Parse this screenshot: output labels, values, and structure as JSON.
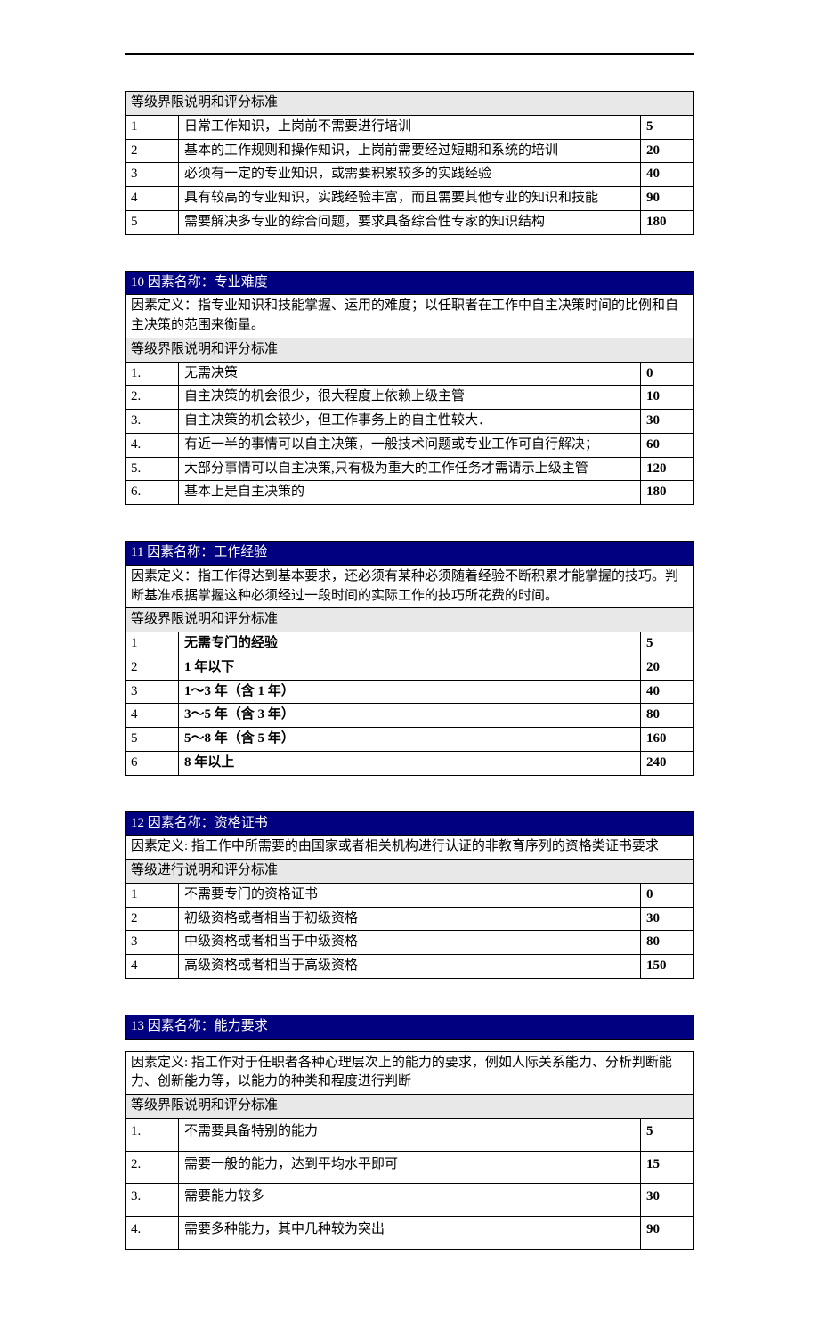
{
  "labels": {
    "scale_header": "等级界限说明和评分标准",
    "scale_header_alt": "等级进行说明和评分标准"
  },
  "block0": {
    "rows": [
      {
        "lvl": "1",
        "desc": "日常工作知识，上岗前不需要进行培训",
        "score": "5"
      },
      {
        "lvl": "2",
        "desc": "基本的工作规则和操作知识，上岗前需要经过短期和系统的培训",
        "score": "20"
      },
      {
        "lvl": "3",
        "desc": "必须有一定的专业知识，或需要积累较多的实践经验",
        "score": "40"
      },
      {
        "lvl": "4",
        "desc": "具有较高的专业知识，实践经验丰富，而且需要其他专业的知识和技能",
        "score": "90"
      },
      {
        "lvl": "5",
        "desc": "需要解决多专业的综合问题，要求具备综合性专家的知识结构",
        "score": "180"
      }
    ]
  },
  "block10": {
    "title": "10 因素名称：专业难度",
    "definition": "因素定义：指专业知识和技能掌握、运用的难度；以任职者在工作中自主决策时间的比例和自主决策的范围来衡量。",
    "rows": [
      {
        "lvl": "1.",
        "desc": "无需决策",
        "score": "0"
      },
      {
        "lvl": "2.",
        "desc": "自主决策的机会很少，很大程度上依赖上级主管",
        "score": "10"
      },
      {
        "lvl": "3.",
        "desc": "自主决策的机会较少，但工作事务上的自主性较大．",
        "score": "30"
      },
      {
        "lvl": "4.",
        "desc": "有近一半的事情可以自主决策，一般技术问题或专业工作可自行解决；",
        "score": "60"
      },
      {
        "lvl": "5.",
        "desc": "大部分事情可以自主决策,只有极为重大的工作任务才需请示上级主管",
        "score": "120"
      },
      {
        "lvl": "6.",
        "desc": "基本上是自主决策的",
        "score": "180"
      }
    ]
  },
  "block11": {
    "title": "11 因素名称：工作经验",
    "definition": "因素定义：指工作得达到基本要求，还必须有某种必须随着经验不断积累才能掌握的技巧。判断基准根据掌握这种必须经过一段时间的实际工作的技巧所花费的时间。",
    "rows": [
      {
        "lvl": "1",
        "desc": "无需专门的经验",
        "score": "5"
      },
      {
        "lvl": "2",
        "desc": "1 年以下",
        "score": "20"
      },
      {
        "lvl": "3",
        "desc": "1～3 年（含 1 年）",
        "score": "40"
      },
      {
        "lvl": "4",
        "desc": "3～5 年（含 3 年）",
        "score": "80"
      },
      {
        "lvl": "5",
        "desc": "5～8 年（含 5 年）",
        "score": "160"
      },
      {
        "lvl": "6",
        "desc": "8 年以上",
        "score": "240"
      }
    ]
  },
  "block12": {
    "title": "12 因素名称：资格证书",
    "definition": "因素定义: 指工作中所需要的由国家或者相关机构进行认证的非教育序列的资格类证书要求",
    "rows": [
      {
        "lvl": "1",
        "desc": "不需要专门的资格证书",
        "score": "0"
      },
      {
        "lvl": "2",
        "desc": "初级资格或者相当于初级资格",
        "score": "30"
      },
      {
        "lvl": "3",
        "desc": "中级资格或者相当于中级资格",
        "score": "80"
      },
      {
        "lvl": "4",
        "desc": "高级资格或者相当于高级资格",
        "score": "150"
      }
    ]
  },
  "block13": {
    "title": "13 因素名称：能力要求",
    "definition": "因素定义: 指工作对于任职者各种心理层次上的能力的要求，例如人际关系能力、分析判断能力、创新能力等，以能力的种类和程度进行判断",
    "rows": [
      {
        "lvl": "1.",
        "desc": "不需要具备特别的能力",
        "score": "5"
      },
      {
        "lvl": "2.",
        "desc": "需要一般的能力，达到平均水平即可",
        "score": "15"
      },
      {
        "lvl": "3.",
        "desc": "需要能力较多",
        "score": "30"
      },
      {
        "lvl": "4.",
        "desc": "需要多种能力，其中几种较为突出",
        "score": "90"
      }
    ]
  }
}
